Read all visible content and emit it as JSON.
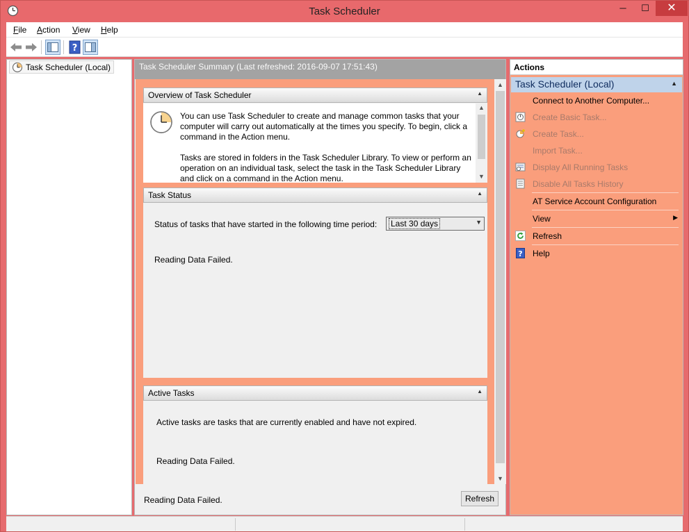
{
  "window": {
    "title": "Task Scheduler",
    "controls": {
      "minimize": "─",
      "maximize": "☐",
      "close": "✕"
    }
  },
  "menubar": {
    "items": [
      {
        "label": "File",
        "access_key": "F"
      },
      {
        "label": "Action",
        "access_key": "A"
      },
      {
        "label": "View",
        "access_key": "V"
      },
      {
        "label": "Help",
        "access_key": "H"
      }
    ]
  },
  "toolbar": {
    "buttons": [
      "back-arrow-icon",
      "forward-arrow-icon",
      "show-hide-console-tree-icon",
      "help-icon",
      "show-hide-action-pane-icon"
    ]
  },
  "tree": {
    "root_label": "Task Scheduler (Local)"
  },
  "center": {
    "header": "Task Scheduler Summary (Last refreshed: 2016-09-07 17:51:43)",
    "overview": {
      "title": "Overview of Task Scheduler",
      "paragraph1": "You can use Task Scheduler to create and manage common tasks that your computer will carry out automatically at the times you specify. To begin, click a command in the Action menu.",
      "paragraph2": "Tasks are stored in folders in the Task Scheduler Library. To view or perform an operation on an individual task, select the task in the Task Scheduler Library and click on a command in the Action menu."
    },
    "task_status": {
      "title": "Task Status",
      "period_label": "Status of tasks that have started in the following time period:",
      "period_value": "Last 30 days",
      "message": "Reading Data Failed."
    },
    "active_tasks": {
      "title": "Active Tasks",
      "description": "Active tasks are tasks that are currently enabled and have not expired.",
      "message": "Reading Data Failed."
    },
    "footer": {
      "message": "Reading Data Failed.",
      "refresh_label": "Refresh"
    }
  },
  "actions": {
    "title": "Actions",
    "group_title": "Task Scheduler (Local)",
    "items": [
      {
        "label": "Connect to Another Computer...",
        "enabled": true
      },
      {
        "label": "Create Basic Task...",
        "enabled": false
      },
      {
        "label": "Create Task...",
        "enabled": false
      },
      {
        "label": "Import Task...",
        "enabled": false
      },
      {
        "label": "Display All Running Tasks",
        "enabled": false
      },
      {
        "label": "Disable All Tasks History",
        "enabled": false
      },
      {
        "label": "AT Service Account Configuration",
        "enabled": true
      },
      {
        "label": "View",
        "enabled": true,
        "submenu": true
      },
      {
        "label": "Refresh",
        "enabled": true
      },
      {
        "label": "Help",
        "enabled": true
      }
    ]
  },
  "colors": {
    "window_frame": "#e66b6e",
    "highlight_panel": "#fa9e7c",
    "actions_group_header": "#bfd3ea",
    "center_header": "#a3a3a3"
  }
}
